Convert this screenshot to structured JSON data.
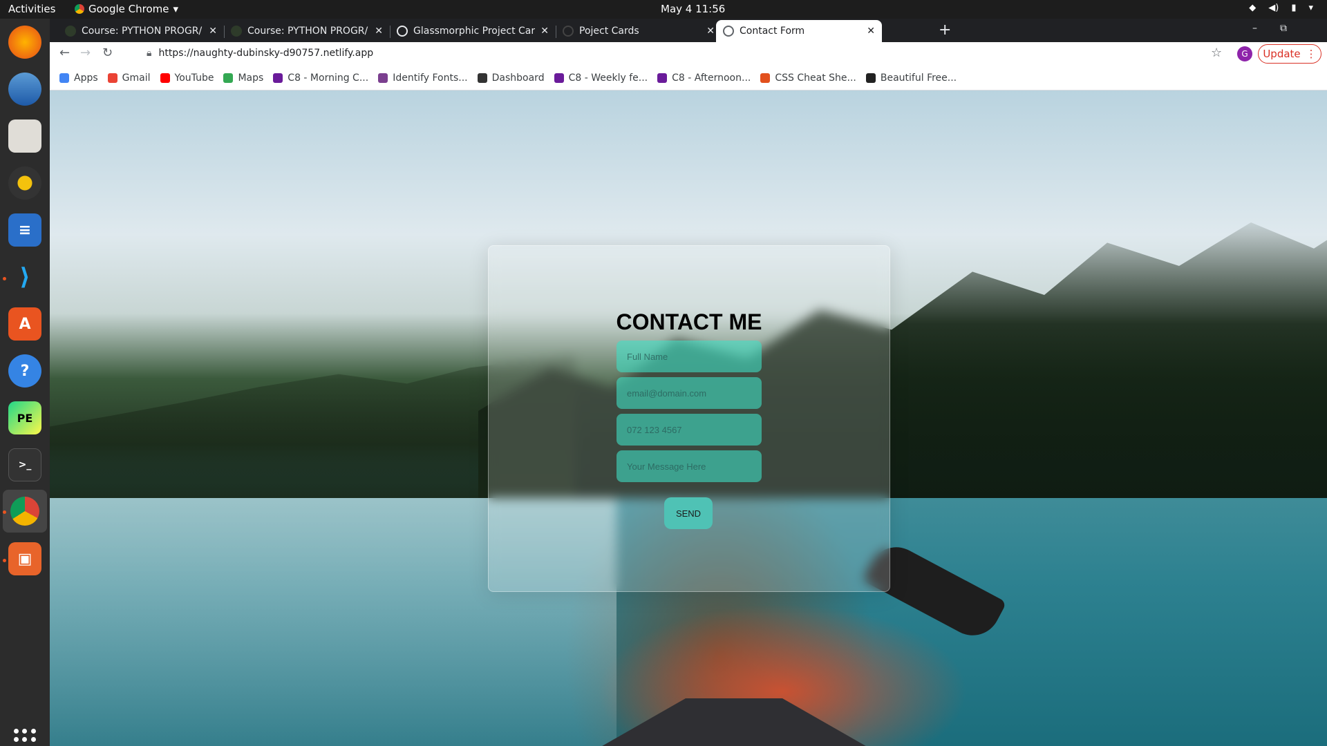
{
  "topbar": {
    "activities": "Activities",
    "app_name": "Google Chrome",
    "clock": "May 4  11:56"
  },
  "dock": {
    "items": [
      "firefox-icon",
      "thunderbird-icon",
      "files-icon",
      "rhythmbox-icon",
      "writer-icon",
      "vscode-icon",
      "software-icon",
      "help-icon",
      "pycharm-icon",
      "terminal-icon",
      "chrome-icon",
      "impress-icon"
    ]
  },
  "tabs": [
    {
      "title": "Course: PYTHON PROGR/",
      "active": false
    },
    {
      "title": "Course: PYTHON PROGR/",
      "active": false
    },
    {
      "title": "Glassmorphic Project Card",
      "active": false
    },
    {
      "title": "Poject Cards",
      "active": false
    },
    {
      "title": "Contact Form",
      "active": true
    }
  ],
  "toolbar": {
    "url": "https://naughty-dubinsky-d90757.netlify.app",
    "profile_initial": "G",
    "update_label": "Update"
  },
  "bookmarks": [
    {
      "label": "Apps",
      "color": "#4285f4"
    },
    {
      "label": "Gmail",
      "color": "#ea4335"
    },
    {
      "label": "YouTube",
      "color": "#ff0000"
    },
    {
      "label": "Maps",
      "color": "#34a853"
    },
    {
      "label": "C8 - Morning C...",
      "color": "#6a1b9a"
    },
    {
      "label": "Identify Fonts...",
      "color": "#7b3f8f"
    },
    {
      "label": "Dashboard",
      "color": "#333333"
    },
    {
      "label": "C8 - Weekly fe...",
      "color": "#6a1b9a"
    },
    {
      "label": "C8 - Afternoon...",
      "color": "#6a1b9a"
    },
    {
      "label": "CSS Cheat She...",
      "color": "#e2501d"
    },
    {
      "label": "Beautiful Free...",
      "color": "#222222"
    }
  ],
  "form": {
    "title": "CONTACT ME",
    "name_placeholder": "Full Name",
    "email_placeholder": "email@domain.com",
    "phone_placeholder": "072 123 4567",
    "message_placeholder": "Your Message Here",
    "send_label": "SEND",
    "field_color": "#40e0c4"
  }
}
